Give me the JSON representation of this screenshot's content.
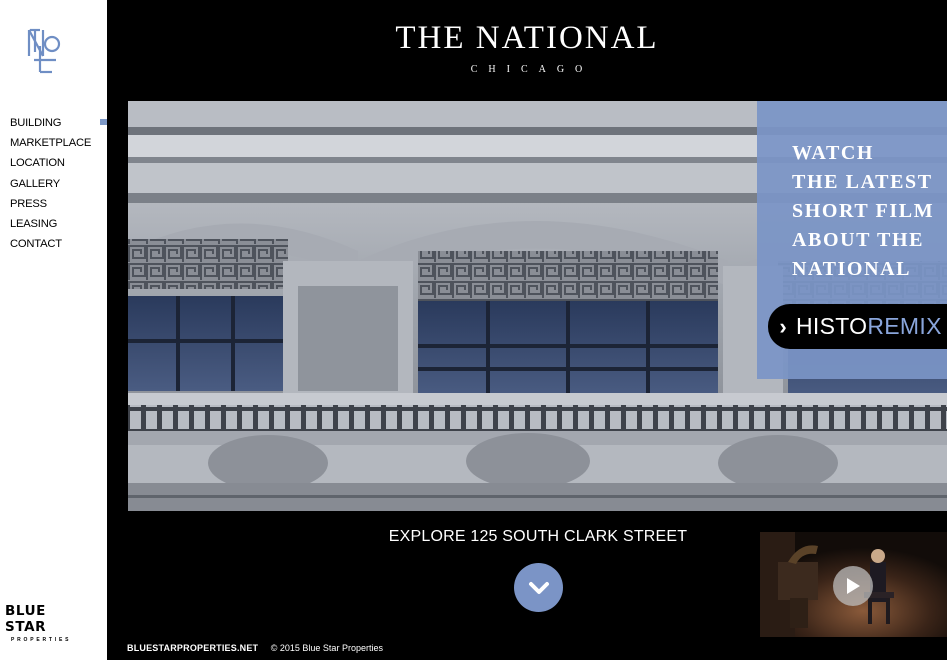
{
  "site": {
    "title": "THE NATIONAL",
    "subtitle": "CHICAGO"
  },
  "sidebar": {
    "logo_icon": "monogram-tnl-icon",
    "items": [
      {
        "label": "BUILDING"
      },
      {
        "label": "MARKETPLACE"
      },
      {
        "label": "LOCATION"
      },
      {
        "label": "GALLERY"
      },
      {
        "label": "PRESS"
      },
      {
        "label": "LEASING"
      },
      {
        "label": "CONTACT"
      }
    ],
    "brand": {
      "name": "BLUE STAR",
      "sub": "PROPERTIES"
    }
  },
  "promo": {
    "lines": [
      "WATCH",
      "THE LATEST",
      "SHORT FILM",
      "ABOUT THE",
      "NATIONAL"
    ],
    "button_part1": "HISTO",
    "button_part2": "REMIX",
    "button_icon": "chevron-right-icon"
  },
  "explore": {
    "label": "EXPLORE 125 SOUTH CLARK STREET",
    "icon": "chevron-down-icon"
  },
  "video": {
    "icon": "play-icon"
  },
  "footer": {
    "site": "BLUESTARPROPERTIES.NET",
    "copyright": "© 2015 Blue Star Properties"
  },
  "colors": {
    "accent": "#7b94c6",
    "background": "#000000",
    "sidebar": "#ffffff"
  }
}
